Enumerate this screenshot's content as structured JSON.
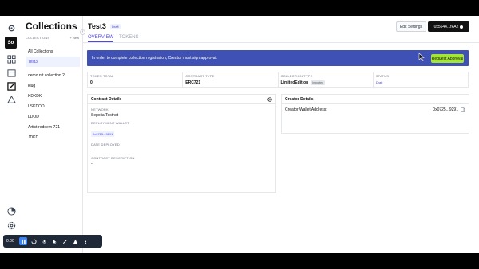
{
  "sidebar": {
    "title": "Collections",
    "subtitle": "COLLECTIONS",
    "new_label": "+ New",
    "items": [
      {
        "label": "All Collections"
      },
      {
        "label": "Test3"
      },
      {
        "label": "demo nft collection 2"
      },
      {
        "label": "kiug"
      },
      {
        "label": "KDKDK"
      },
      {
        "label": "LSKDOD"
      },
      {
        "label": "LDOD"
      },
      {
        "label": "Artist-redeem-721"
      },
      {
        "label": "JDKD"
      }
    ]
  },
  "rail": {
    "workspace_badge": "So",
    "icons": [
      "settings-icon",
      "dashboard-icon",
      "calendar-icon",
      "image-edit-icon",
      "recycle-icon",
      "chart-icon",
      "gear-icon"
    ]
  },
  "header": {
    "title": "Test3",
    "status_pill": "Draft",
    "edit_button": "Edit Settings",
    "wallet": "0x5644...fFA2"
  },
  "tabs": [
    {
      "label": "OVERVIEW",
      "active": true
    },
    {
      "label": "TOKENS",
      "active": false
    }
  ],
  "banner": {
    "text": "In order to complete collection registration, Creator must sign approval.",
    "button": "Request Approval"
  },
  "stats": [
    {
      "label": "TOKEN TOTAL",
      "value": "0"
    },
    {
      "label": "CONTRACT TYPE",
      "value": "ERC721"
    },
    {
      "label": "COLLECTION TYPE",
      "value": "LimitedEdition",
      "pill": "Imported"
    },
    {
      "label": "STATUS",
      "value": "",
      "pill": "Draft"
    }
  ],
  "contract_details": {
    "title": "Contract Details",
    "network_label": "NETWORK",
    "network_value": "Sepolia Testnet",
    "wallet_label": "DEPLOYMENT WALLET",
    "wallet_value": "0x0725...9291",
    "date_label": "DATE DEPLOYED",
    "date_value": "-",
    "desc_label": "CONTRACT DESCRIPTION",
    "desc_value": "-"
  },
  "creator_details": {
    "title": "Creator Details",
    "label": "Creator Wallet Address:",
    "value": "0x0725...9291"
  },
  "recorder": {
    "time": "0:00"
  },
  "colors": {
    "accent": "#4f46e5",
    "banner": "#3f51b5",
    "approve": "#a3e635"
  }
}
